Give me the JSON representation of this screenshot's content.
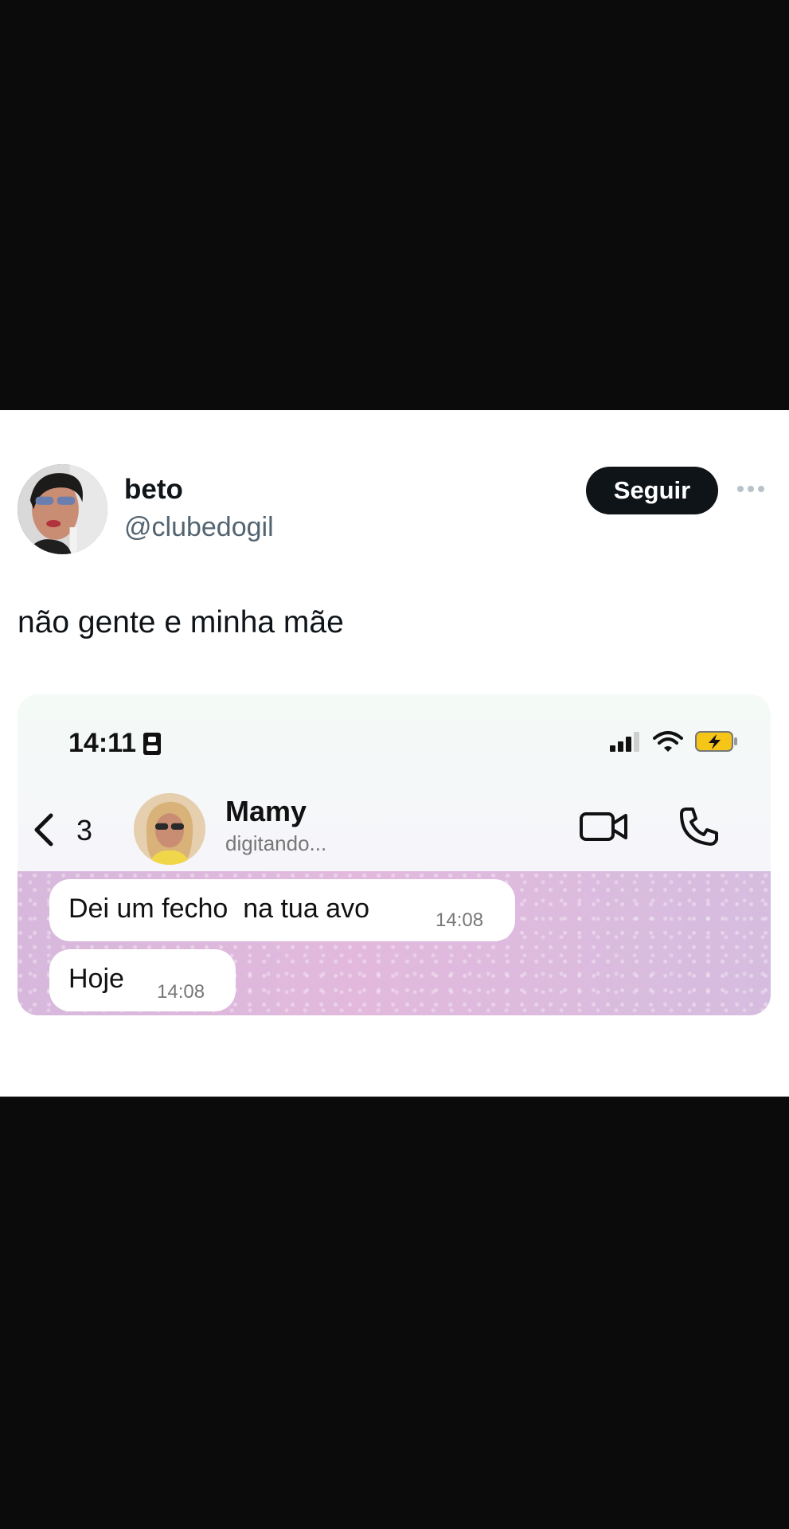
{
  "post": {
    "author_name": "beto",
    "author_handle": "@clubedogil",
    "follow_label": "Seguir",
    "text": "não gente e minha mãe"
  },
  "chat": {
    "status_time": "14:11",
    "back_count": "3",
    "contact_name": "Mamy",
    "contact_status": "digitando...",
    "messages": [
      {
        "text": "Dei um fecho  na tua avo",
        "time": "14:08"
      },
      {
        "text": "Hoje",
        "time": "14:08"
      }
    ]
  },
  "colors": {
    "follow_button_bg": "#0f1419",
    "battery_fill": "#f5c518",
    "chat_wallpaper": "#e2b9dd"
  }
}
